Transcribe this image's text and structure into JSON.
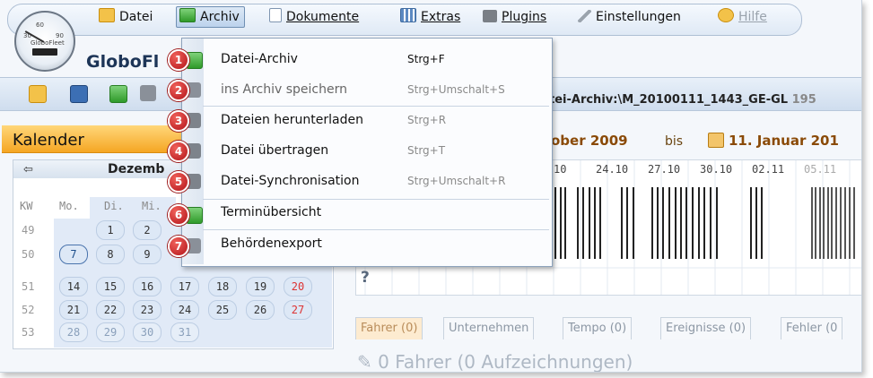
{
  "menubar": {
    "items": [
      {
        "label": "Datei",
        "icon": "folder-icon"
      },
      {
        "label": "Archiv",
        "icon": "database-icon"
      },
      {
        "label": "Dokumente",
        "icon": "document-icon"
      },
      {
        "label": "Extras",
        "icon": "grid-icon"
      },
      {
        "label": "Plugins",
        "icon": "puzzle-icon"
      },
      {
        "label": "Einstellungen",
        "icon": "wrench-icon"
      },
      {
        "label": "Hilfe",
        "icon": "help-icon"
      }
    ]
  },
  "logo": {
    "gauge_text": "GloboFleet",
    "app_title": "GloboFl"
  },
  "toolbar": {
    "path_prefix": "tei-Archiv:",
    "path": "\\M_20100111_1443_GE-GL",
    "path_fade": " 195"
  },
  "calendar": {
    "title": "Kalender",
    "prev_icon": "⇦",
    "month": "Dezemb",
    "headers": [
      "KW",
      "Mo.",
      "Di.",
      "Mi."
    ],
    "weeks": [
      {
        "kw": "49",
        "days": [
          "1",
          "2"
        ]
      },
      {
        "kw": "50",
        "days": [
          "7",
          "8",
          "9"
        ]
      },
      {
        "kw": "51",
        "days": [
          "14",
          "15",
          "16",
          "17",
          "18",
          "19",
          "20"
        ]
      },
      {
        "kw": "52",
        "days": [
          "21",
          "22",
          "23",
          "24",
          "25",
          "26",
          "27"
        ]
      },
      {
        "kw": "53",
        "days": [
          "28",
          "29",
          "30",
          "31"
        ]
      }
    ]
  },
  "range": {
    "from": "ober 2009",
    "bis": "bis",
    "to": "11. Januar 201"
  },
  "chart": {
    "ticks": [
      "10",
      "24.10",
      "27.10",
      "30.10",
      "02.11",
      "05.11"
    ],
    "unknown_marker": "?"
  },
  "tabs": [
    "Fahrer (0)",
    "Unternehmen",
    "Tempo (0)",
    "Ereignisse (0)",
    "Fehler (0"
  ],
  "drivers_title": "0 Fahrer (0 Aufzeichnungen)",
  "dropdown": {
    "items": [
      {
        "num": "1",
        "label": "Datei-Archiv",
        "shortcut": "Strg+F",
        "icon": "database-icon",
        "enabled": true
      },
      {
        "num": "2",
        "label": "ins Archiv speichern",
        "shortcut": "Strg+Umschalt+S",
        "icon": "archive-save-icon",
        "enabled": false
      },
      {
        "num": "3",
        "label": "Dateien herunterladen",
        "shortcut": "Strg+R",
        "icon": "download-icon",
        "enabled": true
      },
      {
        "num": "4",
        "label": "Datei übertragen",
        "shortcut": "Strg+T",
        "icon": "transfer-icon",
        "enabled": true
      },
      {
        "num": "5",
        "label": "Datei-Synchronisation",
        "shortcut": "Strg+Umschalt+R",
        "icon": "sync-icon",
        "enabled": true
      },
      {
        "num": "6",
        "label": "Terminübersicht",
        "shortcut": "",
        "icon": "clock-icon",
        "enabled": true
      },
      {
        "num": "7",
        "label": "Behördenexport",
        "shortcut": "",
        "icon": "export-icon",
        "enabled": true
      }
    ]
  }
}
